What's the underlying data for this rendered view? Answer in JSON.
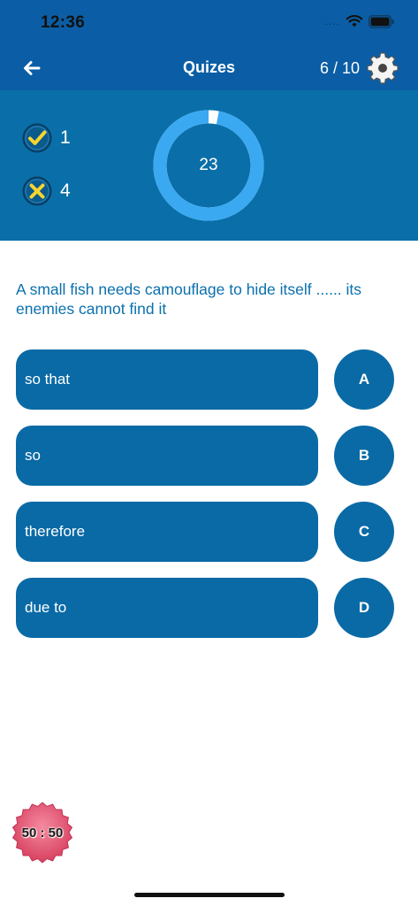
{
  "status_bar": {
    "time": "12:36",
    "signal": "....",
    "icons": [
      "wifi-icon",
      "battery-icon"
    ]
  },
  "nav": {
    "title": "Quizes",
    "progress": "6 / 10",
    "icons": {
      "back": "arrow-left-icon",
      "settings": "gear-icon"
    }
  },
  "score": {
    "correct_count": "1",
    "wrong_count": "4",
    "timer_seconds": "23",
    "timer_fraction_remaining": 0.97,
    "icons": {
      "correct": "check-icon",
      "wrong": "cross-icon"
    }
  },
  "question": {
    "text": "A small fish needs camouflage to hide itself ...... its enemies cannot find it"
  },
  "options": [
    {
      "text": "so that",
      "letter": "A"
    },
    {
      "text": "so",
      "letter": "B"
    },
    {
      "text": "therefore",
      "letter": "C"
    },
    {
      "text": "due to",
      "letter": "D"
    }
  ],
  "lifeline": {
    "label": "50 : 50"
  },
  "colors": {
    "header": "#0b5ea5",
    "panel": "#0a6fa8",
    "button": "#0a6aa6",
    "timer_ring": "#3aa9f2",
    "question_text": "#0b70ad",
    "lifeline": "#e85a78"
  }
}
